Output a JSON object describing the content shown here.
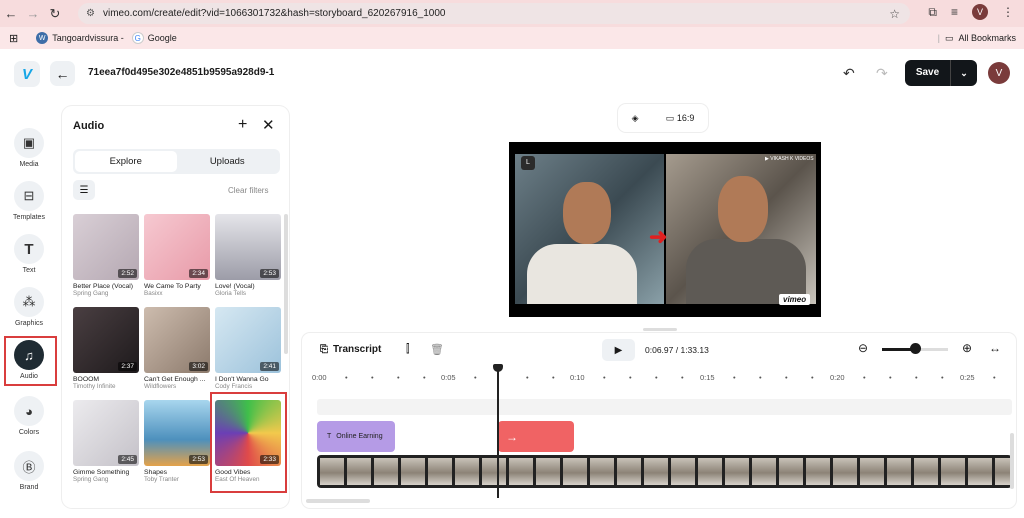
{
  "browser": {
    "url": "vimeo.com/create/edit?vid=1066301732&hash=storyboard_620267916_1000",
    "bookmarks": [
      {
        "label": "Tangoardvissura -"
      },
      {
        "label": "Google"
      }
    ],
    "all_bookmarks": "All Bookmarks",
    "profile_initial": "V"
  },
  "header": {
    "logo": "V",
    "project_title": "71eea7f0d495e302e4851b9595a928d9-1",
    "save_label": "Save",
    "user_initial": "V"
  },
  "rail": {
    "items": [
      {
        "label": "Media",
        "icon": "image-icon"
      },
      {
        "label": "Templates",
        "icon": "layout-icon"
      },
      {
        "label": "Text",
        "icon": "text-icon"
      },
      {
        "label": "Graphics",
        "icon": "shapes-icon"
      },
      {
        "label": "Audio",
        "icon": "music-note-icon"
      },
      {
        "label": "Colors",
        "icon": "palette-icon"
      },
      {
        "label": "Brand",
        "icon": "brand-icon"
      }
    ]
  },
  "audio_panel": {
    "title": "Audio",
    "tabs": [
      "Explore",
      "Uploads"
    ],
    "clear_filters": "Clear filters",
    "tracks": [
      {
        "name": "Better Place (Vocal)",
        "artist": "Spring Gang",
        "duration": "2:52",
        "color": "#cfc6cf"
      },
      {
        "name": "We Came To Party",
        "artist": "Basixx",
        "duration": "2:34",
        "color": "#f0b4bf"
      },
      {
        "name": "Love! (Vocal)",
        "artist": "Gloria Tells",
        "duration": "2:53",
        "color": "#c9c9d1"
      },
      {
        "name": "BOOOM",
        "artist": "Timothy Infinite",
        "duration": "2:37",
        "color": "#3c3537"
      },
      {
        "name": "Can't Get Enough ...",
        "artist": "Wildflowers",
        "duration": "3:02",
        "color": "#b7a497"
      },
      {
        "name": "I Don't Wanna Go",
        "artist": "Cody Francis",
        "duration": "2:41",
        "color": "#b8d4e6"
      },
      {
        "name": "Gimme Something",
        "artist": "Spring Gang",
        "duration": "2:45",
        "color": "#d9d6db"
      },
      {
        "name": "Shapes",
        "artist": "Toby Tranter",
        "duration": "2:53",
        "color": "#7fb6d6"
      },
      {
        "name": "Good Vibes",
        "artist": "East Of Heaven",
        "duration": "2:33",
        "color": "#3fbf4a"
      }
    ]
  },
  "canvas": {
    "aspect_ratio": "16:9",
    "watermark": "vimeo",
    "brand_tag": "▶ VIKASH K VIDEOS"
  },
  "timeline": {
    "transcript_label": "Transcript",
    "current_time": "0:06.97",
    "total_time": "1:33.13",
    "ruler_labels": [
      "0:00",
      "0:05",
      "0:10",
      "0:15",
      "0:20",
      "0:25"
    ],
    "text_clip_label": "Online Earning",
    "zoom_level": 0.5
  }
}
